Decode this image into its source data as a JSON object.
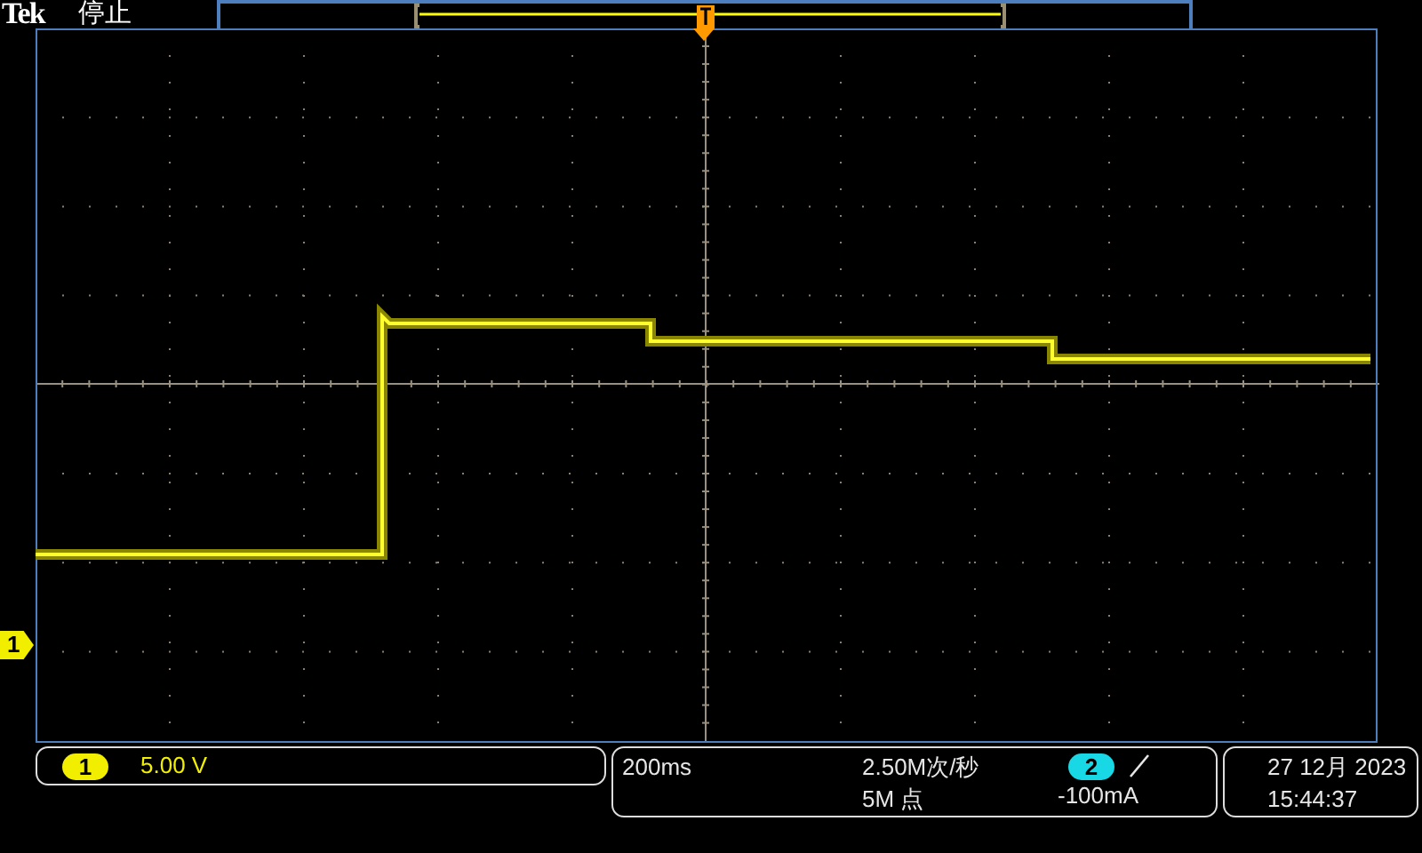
{
  "header": {
    "brand": "Tek",
    "acquisition_state": "停止"
  },
  "ground_marker": {
    "label": "1"
  },
  "channel1": {
    "badge": "1",
    "scale": "5.00 V"
  },
  "timebase": {
    "scale": "200ms",
    "sample_rate": "2.50M次/秒",
    "record_length": "5M 点"
  },
  "trigger": {
    "source": "2",
    "slope_rising": true,
    "threshold": "-100mA"
  },
  "datetime": {
    "date": "27 12月 2023",
    "time": "15:44:37"
  }
}
